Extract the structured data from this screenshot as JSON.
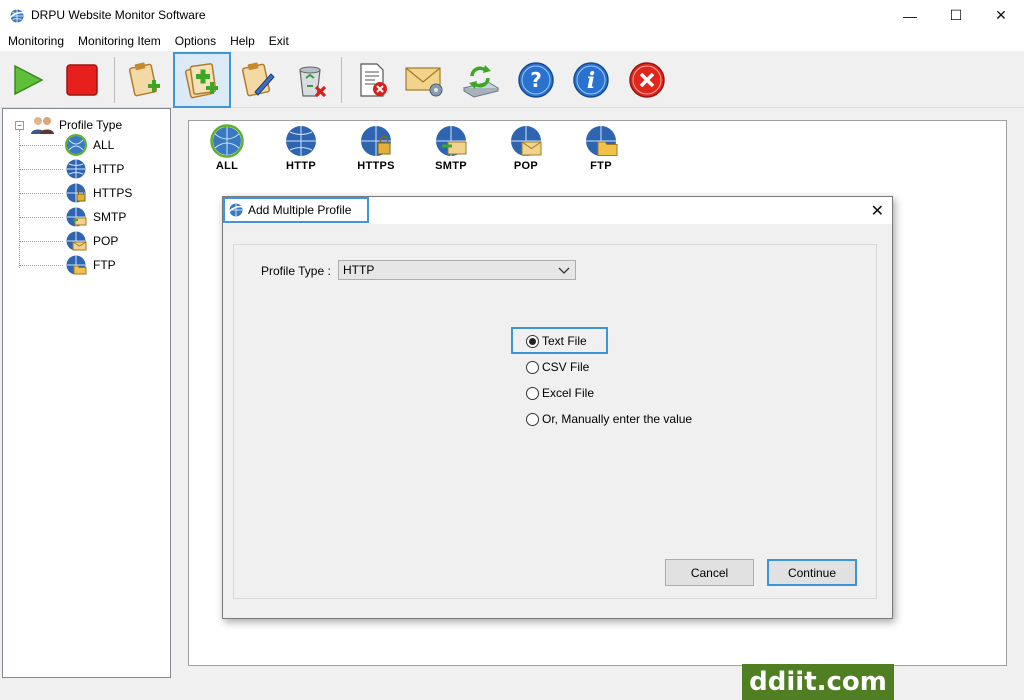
{
  "window": {
    "title": "DRPU Website Monitor Software",
    "minimize": "—",
    "maximize": "☐",
    "close": "✕"
  },
  "menu": [
    "Monitoring",
    "Monitoring Item",
    "Options",
    "Help",
    "Exit"
  ],
  "toolbar": {
    "buttons": [
      {
        "icon": "play-icon"
      },
      {
        "icon": "stop-icon"
      },
      {
        "icon": "add-profile-icon"
      },
      {
        "icon": "add-multiple-profile-icon",
        "active": true
      },
      {
        "icon": "edit-profile-icon"
      },
      {
        "icon": "delete-profile-icon"
      },
      {
        "icon": "report-delete-icon"
      },
      {
        "icon": "email-settings-icon"
      },
      {
        "icon": "refresh-icon"
      },
      {
        "icon": "help-icon"
      },
      {
        "icon": "info-icon"
      },
      {
        "icon": "exit-icon"
      }
    ]
  },
  "tree": {
    "root": "Profile Type",
    "expander": "−",
    "items": [
      "ALL",
      "HTTP",
      "HTTPS",
      "SMTP",
      "POP",
      "FTP"
    ]
  },
  "profile_types": [
    "ALL",
    "HTTP",
    "HTTPS",
    "SMTP",
    "POP",
    "FTP"
  ],
  "dialog": {
    "title": "Add Multiple Profile",
    "close": "✕",
    "profile_type_label": "Profile Type :",
    "profile_type_value": "HTTP",
    "options": [
      {
        "label": "Text File",
        "checked": true
      },
      {
        "label": "CSV File",
        "checked": false
      },
      {
        "label": "Excel File",
        "checked": false
      },
      {
        "label": "Or, Manually enter the value",
        "checked": false
      }
    ],
    "cancel": "Cancel",
    "continue": "Continue"
  },
  "watermark": "ddiit.com",
  "colors": {
    "focus": "#3d96d8",
    "watermark_bg": "#4f7f22"
  }
}
